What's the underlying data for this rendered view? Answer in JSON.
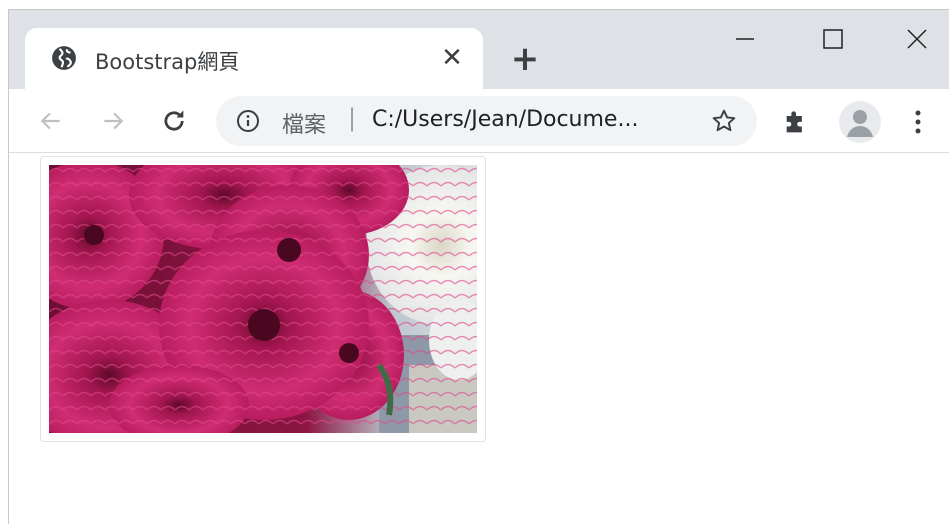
{
  "tab": {
    "title": "Bootstrap網頁",
    "close_label": "✕",
    "favicon": "globe-icon"
  },
  "newtab": {
    "label": "+"
  },
  "window_controls": {
    "minimize": "minimize-icon",
    "maximize": "maximize-icon",
    "close": "close-icon"
  },
  "toolbar": {
    "back": "back-arrow-icon",
    "forward": "forward-arrow-icon",
    "reload": "reload-icon",
    "extensions": "puzzle-icon",
    "profile": "avatar-icon",
    "menu": "kebab-menu-icon"
  },
  "omnibox": {
    "info_icon": "info-icon",
    "scheme_label": "檔案",
    "separator": "|",
    "url": "C:/Users/Jean/Docume...",
    "bookmark_icon": "star-icon"
  },
  "page": {
    "image": {
      "kind": "photo",
      "subject": "flowers",
      "style": "img-thumbnail"
    }
  },
  "colors": {
    "titlebar": "#dee1e6",
    "omnibox": "#f1f3f4",
    "tab_text": "#3c4043",
    "border": "#dee2e6",
    "flower_magenta": "#b4195e",
    "flower_white": "#f6f6f2"
  }
}
